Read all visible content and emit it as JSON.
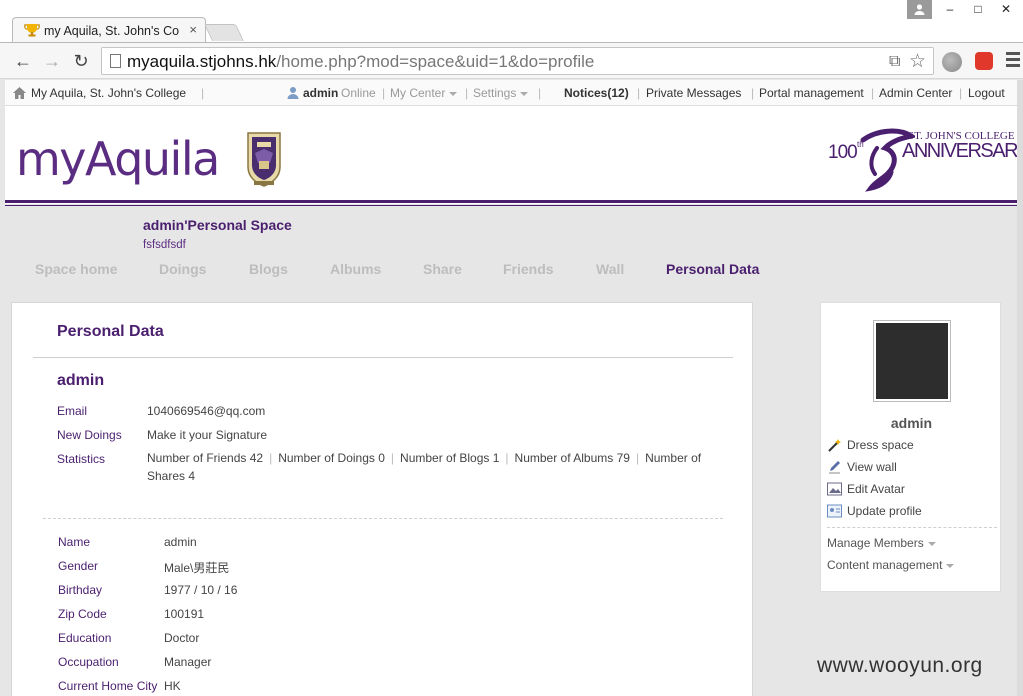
{
  "browser": {
    "tab_title": "my Aquila, St. John's Co",
    "tab_close": "×",
    "url_host": "myaquila.stjohns.hk",
    "url_path": "/home.php?mod=space&uid=1&do=profile",
    "window_buttons": {
      "minimize": "–",
      "maximize": "□",
      "close": "✕"
    },
    "nav": {
      "back": "←",
      "forward": "→",
      "reload": "↻"
    },
    "omnibox_icons": {
      "translate": "⧉",
      "star": "☆"
    }
  },
  "topbar": {
    "site_link": "My Aquila, St. John's College",
    "username": "admin",
    "online": "Online",
    "separator": "|",
    "my_center": "My Center",
    "settings": "Settings",
    "notices": "Notices(12)",
    "private_messages": "Private Messages",
    "portal_management": "Portal management",
    "admin_center": "Admin Center",
    "logout": "Logout"
  },
  "header": {
    "logo": "myAquila",
    "anniversary_top": "ST. JOHN'S COLLEGE",
    "anniversary_num": "100",
    "anniversary_sup": "th",
    "anniversary_word": "ANNIVERSARY"
  },
  "space": {
    "title": "admin'Personal Space",
    "subtitle": "fsfsdfsdf",
    "nav": [
      "Space home",
      "Doings",
      "Blogs",
      "Albums",
      "Share",
      "Friends",
      "Wall",
      "Personal Data"
    ],
    "active_index": 7
  },
  "profile": {
    "panel_title": "Personal Data",
    "name": "admin",
    "summary": [
      {
        "label": "Email",
        "value": "1040669546@qq.com"
      },
      {
        "label": "New Doings",
        "value": "Make it your Signature"
      },
      {
        "label": "Statistics",
        "value": ""
      }
    ],
    "stats": [
      "Number of Friends 42",
      "Number of Doings 0",
      "Number of Blogs 1",
      "Number of Albums 79",
      "Number of Shares 4"
    ],
    "details": [
      {
        "label": "Name",
        "value": "admin"
      },
      {
        "label": "Gender",
        "value": "Male\\男莊民"
      },
      {
        "label": "Birthday",
        "value": "1977 / 10 / 16"
      },
      {
        "label": "Zip Code",
        "value": "100191"
      },
      {
        "label": "Education",
        "value": "Doctor"
      },
      {
        "label": "Occupation",
        "value": "Manager"
      },
      {
        "label": "Current Home City",
        "value": "HK"
      }
    ]
  },
  "sidebar": {
    "name": "admin",
    "actions": [
      "Dress space",
      "View wall",
      "Edit Avatar",
      "Update profile"
    ],
    "menus": [
      "Manage Members",
      "Content management"
    ]
  },
  "watermark": "www.wooyun.org",
  "colors": {
    "brand_purple": "#4a1f6e",
    "logo_purple": "#5b2d82",
    "muted_nav": "#bdbdbd"
  }
}
